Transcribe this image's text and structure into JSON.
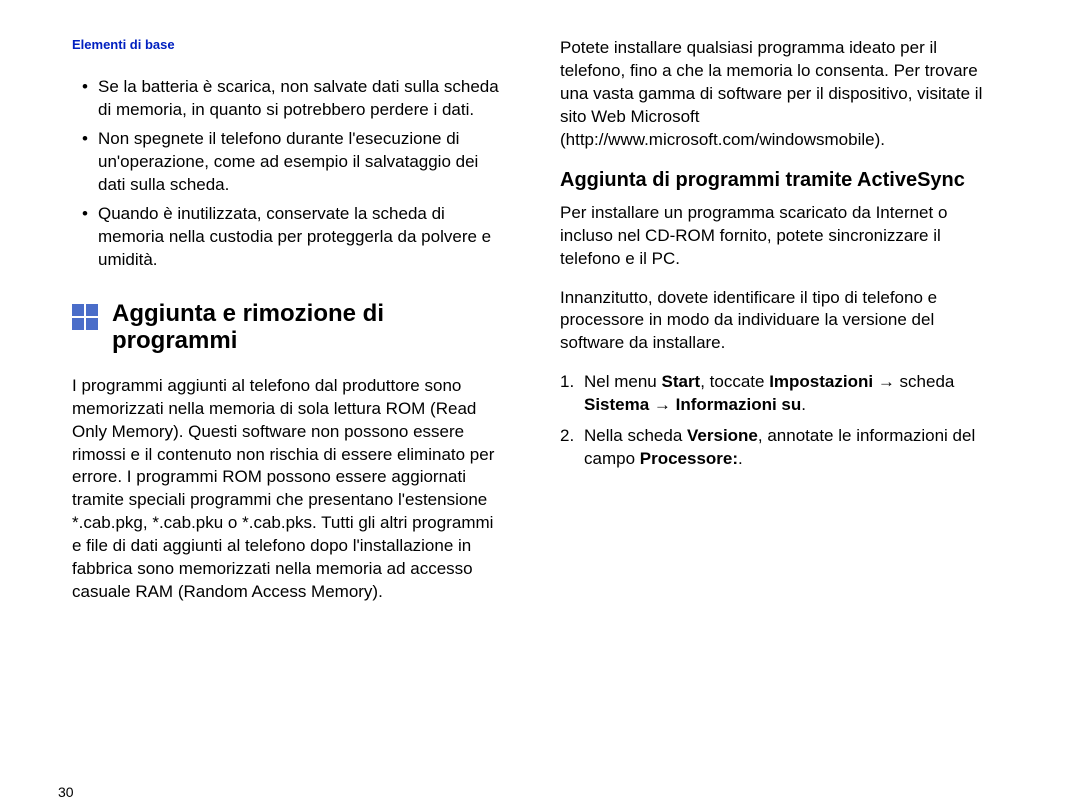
{
  "header": "Elementi di base",
  "page_number": "30",
  "left": {
    "bullets": [
      "Se la batteria è scarica, non salvate dati sulla scheda di memoria, in quanto si potrebbero perdere i dati.",
      "Non spegnete il telefono durante l'esecuzione di un'operazione, come ad esempio il salvataggio dei dati sulla scheda.",
      "Quando è inutilizzata, conservate la scheda di memoria nella custodia per proteggerla da polvere e umidità."
    ],
    "heading": "Aggiunta e rimozione di programmi",
    "para": "I programmi aggiunti al telefono dal produttore sono memorizzati nella memoria di sola lettura ROM (Read Only Memory). Questi software non possono essere rimossi e il contenuto non rischia di essere eliminato per errore. I programmi ROM possono essere aggiornati tramite speciali programmi che presentano l'estensione *.cab.pkg, *.cab.pku o *.cab.pks. Tutti gli altri programmi e file di dati aggiunti al telefono dopo l'installazione in fabbrica sono memorizzati nella memoria ad accesso casuale RAM (Random Access Memory)."
  },
  "right": {
    "top_para": "Potete installare qualsiasi programma ideato per il telefono, fino a che la memoria lo consenta. Per trovare una vasta gamma di software per il dispositivo, visitate il sito Web Microsoft (http://www.microsoft.com/windowsmobile).",
    "sub_heading": "Aggiunta di programmi tramite ActiveSync",
    "para2": "Per installare un programma scaricato da Internet o incluso nel CD-ROM fornito, potete sincronizzare il telefono e il PC.",
    "para3": "Innanzitutto, dovete identificare il tipo di telefono e processore in modo da individuare la versione del software da installare.",
    "steps_html": [
      "Nel menu <b>Start</b>, toccate <b>Impostazioni</b> → scheda <b>Sistema</b> → <b>Informazioni su</b>.",
      "Nella scheda <b>Versione</b>, annotate le informazioni del campo <b>Processore:</b>."
    ]
  }
}
